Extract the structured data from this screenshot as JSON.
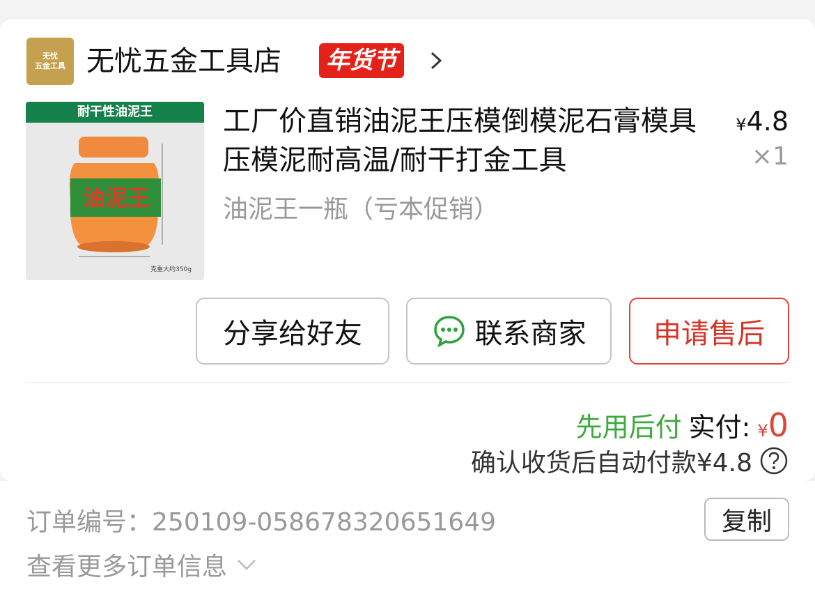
{
  "shop": {
    "logo_text": "无忧\n五金工具",
    "name": "无忧五金工具店",
    "badge": "年货节"
  },
  "product": {
    "thumb_banner": "耐干性油泥王",
    "thumb_label": "油泥王",
    "thumb_caption": "克重大约350g",
    "title": "工厂价直销油泥王压模倒模泥石膏模具 压模泥耐高温/耐干打金工具",
    "spec": "油泥王一瓶（亏本促销）",
    "price_symbol": "¥",
    "price": "4.8",
    "quantity": "×1"
  },
  "actions": {
    "share": "分享给好友",
    "contact": "联系商家",
    "after_sale": "申请售后"
  },
  "payment": {
    "tag": "先用后付",
    "label": "实付:",
    "amount_symbol": "¥",
    "amount": "0",
    "note": "确认收货后自动付款¥4.8"
  },
  "order": {
    "number_label": "订单编号：",
    "number": "250109-058678320651649",
    "copy": "复制",
    "more": "查看更多订单信息"
  },
  "colors": {
    "accent_red": "#e4221a",
    "green": "#3caa3c",
    "shop_logo": "#c5a14f"
  }
}
